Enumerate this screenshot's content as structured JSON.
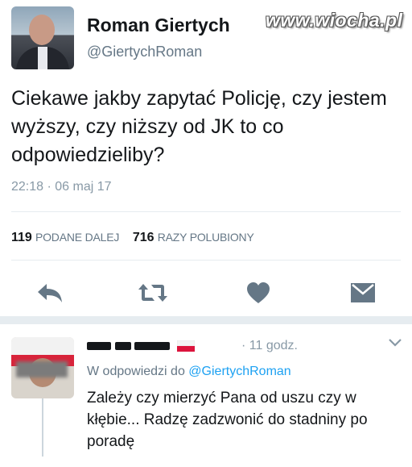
{
  "tweet": {
    "author_name": "Roman Giertych",
    "author_handle": "@GiertychRoman",
    "text": "Ciekawe jakby zapytać Policję, czy jestem wyższy, czy niższy od JK to co odpowiedzieliby?",
    "timestamp": "22:18 · 06 maj 17",
    "retweets_count": "119",
    "retweets_label": "PODANE DALEJ",
    "likes_count": "716",
    "likes_label": "RAZY POLUBIONY"
  },
  "watermark": "www.wiocha.pl",
  "actions": [
    {
      "name": "reply-icon"
    },
    {
      "name": "retweet-icon"
    },
    {
      "name": "like-icon"
    },
    {
      "name": "direct-message-icon"
    }
  ],
  "reply": {
    "time": "· 11 godz.",
    "in_reply_prefix": "W odpowiedzi do",
    "in_reply_handle": "@GiertychRoman",
    "text": "Zależy czy mierzyć Pana od uszu czy w kłębie... Radzę zadzwonić do stadniny po poradę"
  },
  "colors": {
    "accent": "#1da1f2",
    "text": "#14171a",
    "muted": "#657786",
    "icon": "#657786"
  }
}
